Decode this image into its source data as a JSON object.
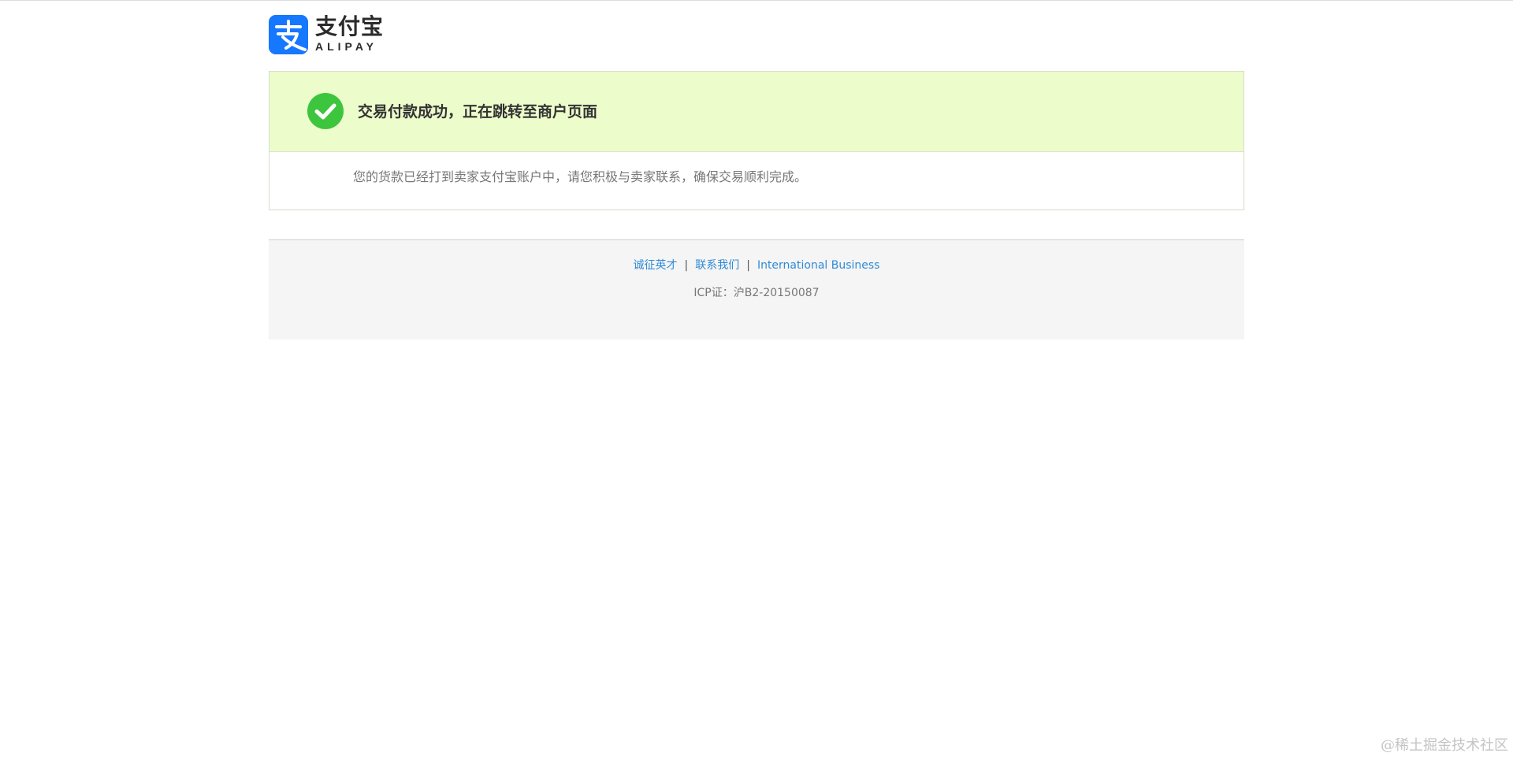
{
  "brand": {
    "name_cn": "支付宝",
    "name_en": "ALIPAY",
    "accent_color": "#1677ff",
    "logo_icon": "alipay-logo-icon"
  },
  "result": {
    "status": "success",
    "status_icon": "check-circle-icon",
    "status_color": "#3ec53e",
    "title": "交易付款成功，正在跳转至商户页面",
    "description": "您的货款已经打到卖家支付宝账户中，请您积极与卖家联系，确保交易顺利完成。"
  },
  "footer": {
    "links": [
      {
        "label": "诚征英才"
      },
      {
        "label": "联系我们"
      },
      {
        "label": "International Business"
      }
    ],
    "separator": "|",
    "icp": "ICP证：沪B2-20150087"
  },
  "watermark": "@稀土掘金技术社区"
}
